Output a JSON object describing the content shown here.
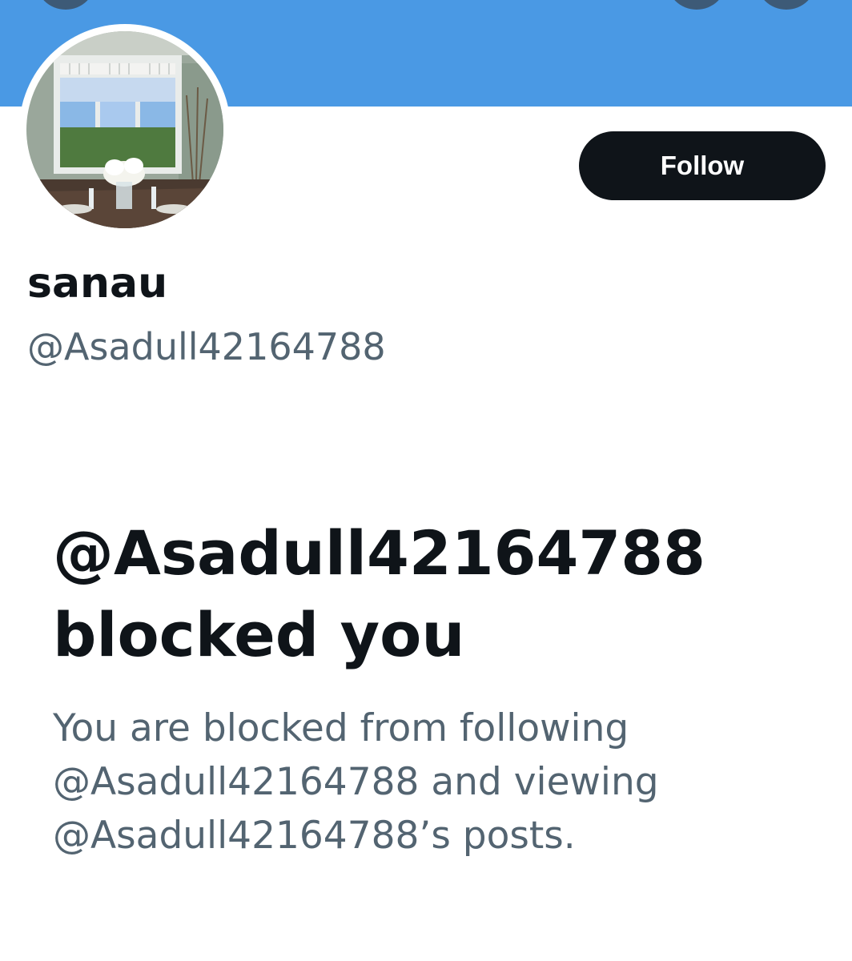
{
  "profile": {
    "display_name": "sanau",
    "handle": "@Asadull42164788",
    "avatar_alt": "profile photo"
  },
  "actions": {
    "follow_label": "Follow"
  },
  "blocked_notice": {
    "title_line1": "@Asadull42164788",
    "title_line2": "blocked you",
    "desc_line1": "You are blocked from following",
    "desc_line2": "@Asadull42164788 and viewing",
    "desc_line3": "@Asadull42164788’s posts."
  },
  "colors": {
    "banner": "#4a99e4",
    "follow_button": "#0f1419",
    "primary_text": "#0f1419",
    "secondary_text": "#536471"
  },
  "icons": [
    "back-arrow-icon",
    "search-icon",
    "more-options-icon"
  ]
}
